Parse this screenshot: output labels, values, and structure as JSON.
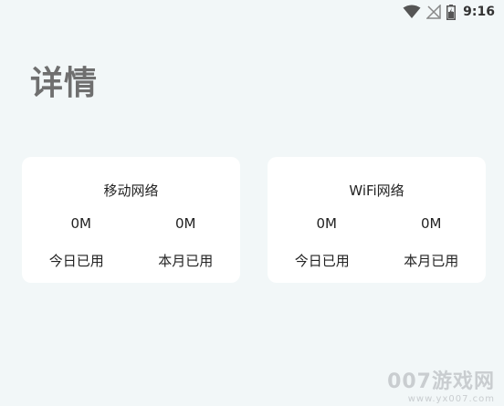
{
  "status_bar": {
    "time": "9:16",
    "icons": [
      "wifi-icon",
      "no-signal-icon",
      "battery-charging-icon"
    ]
  },
  "page": {
    "title": "详情"
  },
  "cards": {
    "mobile": {
      "title": "移动网络",
      "today_value": "0M",
      "month_value": "0M",
      "today_label": "今日已用",
      "month_label": "本月已用"
    },
    "wifi": {
      "title": "WiFi网络",
      "today_value": "0M",
      "month_value": "0M",
      "today_label": "今日已用",
      "month_label": "本月已用"
    }
  },
  "watermark": {
    "brand": "007游戏网",
    "url": "www.yx007.com"
  },
  "colors": {
    "background": "#f2f7f8",
    "card": "#ffffff",
    "title": "#6f6f6f",
    "text": "#222222"
  }
}
